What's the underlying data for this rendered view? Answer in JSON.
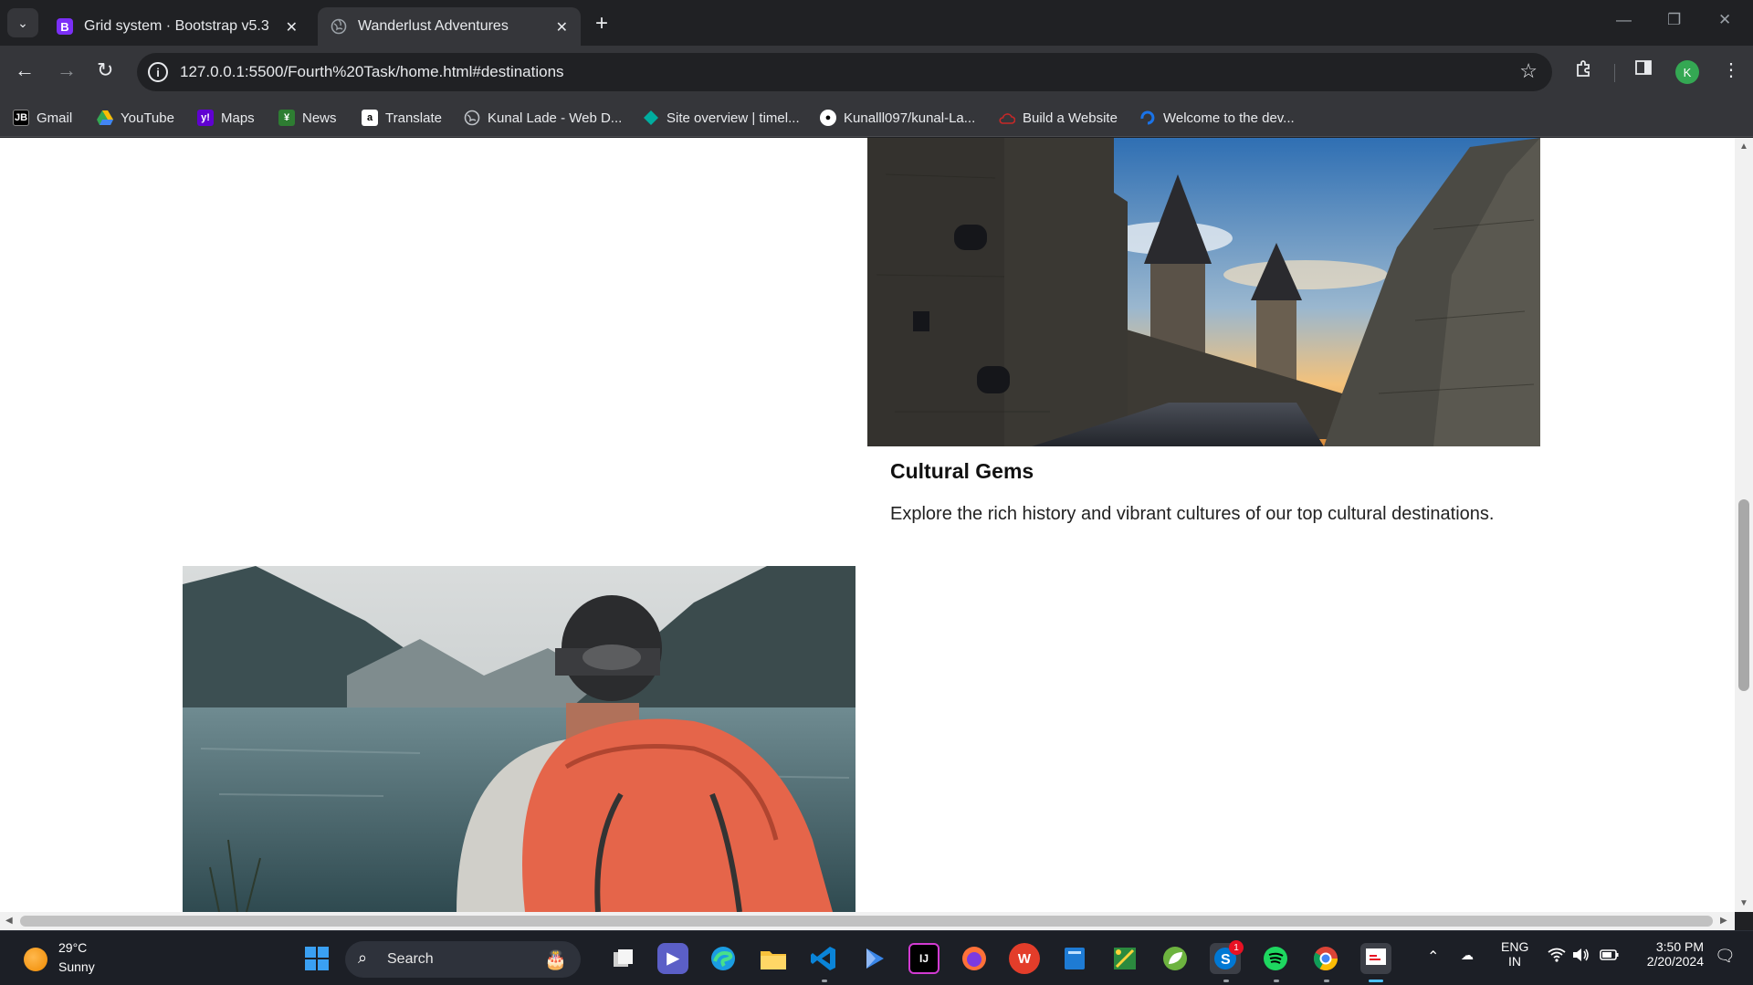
{
  "browser": {
    "tabs": [
      {
        "title": "Grid system · Bootstrap v5.3",
        "favicon": "B"
      },
      {
        "title": "Wanderlust Adventures",
        "favicon": "globe"
      }
    ],
    "new_tab_label": "+",
    "url": "127.0.0.1:5500/Fourth%20Task/home.html#destinations",
    "profile_initial": "K"
  },
  "bookmarks": [
    {
      "label": "Gmail",
      "icon": "JB"
    },
    {
      "label": "YouTube",
      "icon": "drive-icon"
    },
    {
      "label": "Maps",
      "icon": "y!"
    },
    {
      "label": "News",
      "icon": "news-icon"
    },
    {
      "label": "Translate",
      "icon": "a"
    },
    {
      "label": "Kunal Lade - Web D...",
      "icon": "globe-icon"
    },
    {
      "label": "Site overview | timel...",
      "icon": "diamond-icon"
    },
    {
      "label": "Kunalll097/kunal-La...",
      "icon": "github-icon"
    },
    {
      "label": "Build a Website",
      "icon": "cloud-icon"
    },
    {
      "label": "Welcome to the dev...",
      "icon": "swirl-icon"
    }
  ],
  "page": {
    "card": {
      "title": "Cultural Gems",
      "text": "Explore the rich history and vibrant cultures of our top cultural destinations."
    }
  },
  "taskbar": {
    "weather": {
      "temp": "29°C",
      "condition": "Sunny"
    },
    "search_placeholder": "Search",
    "language": {
      "line1": "ENG",
      "line2": "IN"
    },
    "clock": {
      "time": "3:50 PM",
      "date": "2/20/2024"
    },
    "skype_badge": "1"
  },
  "colors": {
    "chrome_bg": "#202124",
    "toolbar_bg": "#35363a",
    "page_bg": "#ffffff",
    "taskbar_bg": "#1c1f26"
  }
}
